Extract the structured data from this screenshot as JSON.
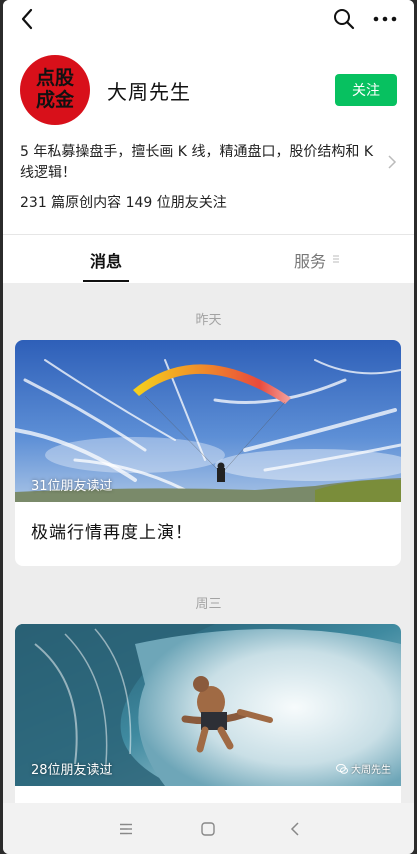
{
  "account": {
    "name": "大周先生",
    "avatar_text_line1": "点股",
    "avatar_text_line2": "成金",
    "follow_label": "关注",
    "bio": "5 年私募操盘手，擅长画 K 线，精通盘口，股价结构和 K 线逻辑！",
    "stats": "231 篇原创内容  149 位朋友关注"
  },
  "tabs": [
    {
      "label": "消息",
      "active": true
    },
    {
      "label": "服务",
      "active": false
    }
  ],
  "feed": [
    {
      "date_label": "昨天",
      "readers": "31位朋友读过",
      "title": "极端行情再度上演！"
    },
    {
      "date_label": "周三",
      "readers": "28位朋友读过",
      "watermark": "大周先生",
      "title": ""
    }
  ],
  "colors": {
    "accent": "#07c160",
    "avatar_bg": "#d8101a",
    "page_bg": "#ededed"
  },
  "icons": {
    "back": "chevron-left",
    "search": "magnifier",
    "more": "ellipsis",
    "bio_more": "chevron-right",
    "menu": "three-lines",
    "home": "rounded-square",
    "nav_back": "chevron-left"
  }
}
